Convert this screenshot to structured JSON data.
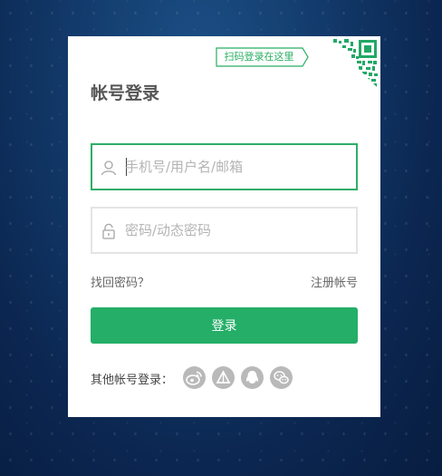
{
  "page": {
    "accent_color": "#24ae67",
    "background_color": "#0b2650"
  },
  "login": {
    "qr_tip": "扫码登录在这里",
    "qr_icon": "qr-code-icon",
    "title": "帐号登录",
    "username": {
      "placeholder": "手机号/用户名/邮箱",
      "value": "",
      "icon": "user-icon"
    },
    "password": {
      "placeholder": "密码/动态密码",
      "value": "",
      "icon": "lock-icon"
    },
    "forgot_label": "找回密码？",
    "register_label": "注册帐号",
    "submit_label": "登录",
    "social_label": "其他帐号登录：",
    "social": [
      {
        "icon": "weibo-icon"
      },
      {
        "icon": "baidu-icon"
      },
      {
        "icon": "qq-icon"
      },
      {
        "icon": "wechat-icon"
      }
    ]
  }
}
